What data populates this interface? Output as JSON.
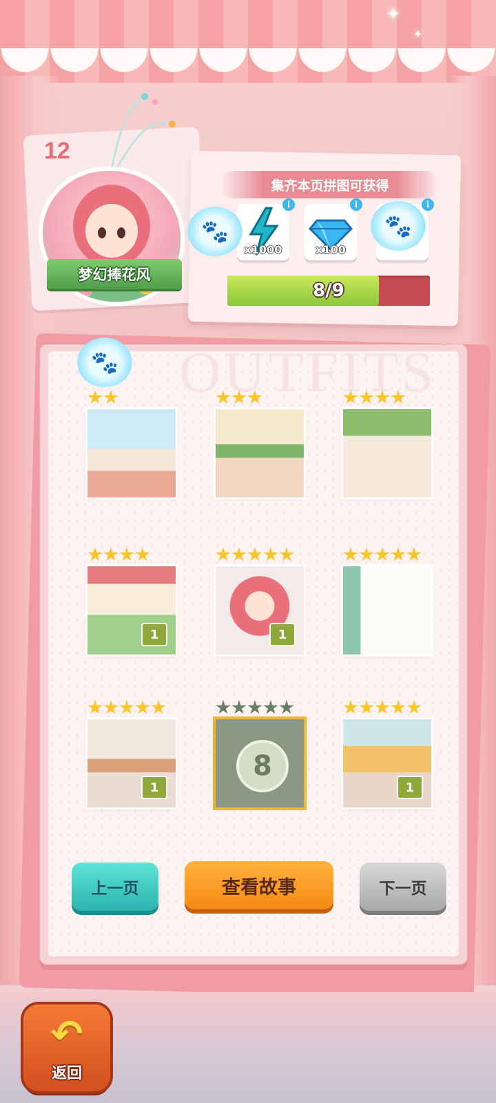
{
  "header": {
    "page_number": "12",
    "outfit_name": "梦幻捧花风"
  },
  "rewards": {
    "title": "集齐本页拼图可获得",
    "items": [
      {
        "icon": "lightning-icon",
        "qty": "x1000"
      },
      {
        "icon": "diamond-icon",
        "qty": "x100"
      },
      {
        "icon": "avatar-frame-icon",
        "qty": ""
      }
    ],
    "progress": {
      "text": "8/9",
      "collected": 8,
      "total": 9
    }
  },
  "book": {
    "watermark": "OUTFITS",
    "pieces": [
      {
        "stars": 2,
        "count": "",
        "locked": false
      },
      {
        "stars": 3,
        "count": "",
        "locked": false
      },
      {
        "stars": 4,
        "count": "",
        "locked": false
      },
      {
        "stars": 4,
        "count": "1",
        "locked": false
      },
      {
        "stars": 5,
        "count": "1",
        "locked": false
      },
      {
        "stars": 5,
        "count": "",
        "locked": false
      },
      {
        "stars": 5,
        "count": "1",
        "locked": false
      },
      {
        "stars": 5,
        "count": "",
        "locked": true,
        "lock_number": "8"
      },
      {
        "stars": 5,
        "count": "1",
        "locked": false
      }
    ]
  },
  "buttons": {
    "prev": "上一页",
    "story": "查看故事",
    "next": "下一页",
    "back": "返回"
  },
  "colors": {
    "star": "#f9c52b",
    "star_locked": "#6a7e63",
    "progress_fill": "#8cc63a",
    "progress_track": "#c44b50"
  }
}
